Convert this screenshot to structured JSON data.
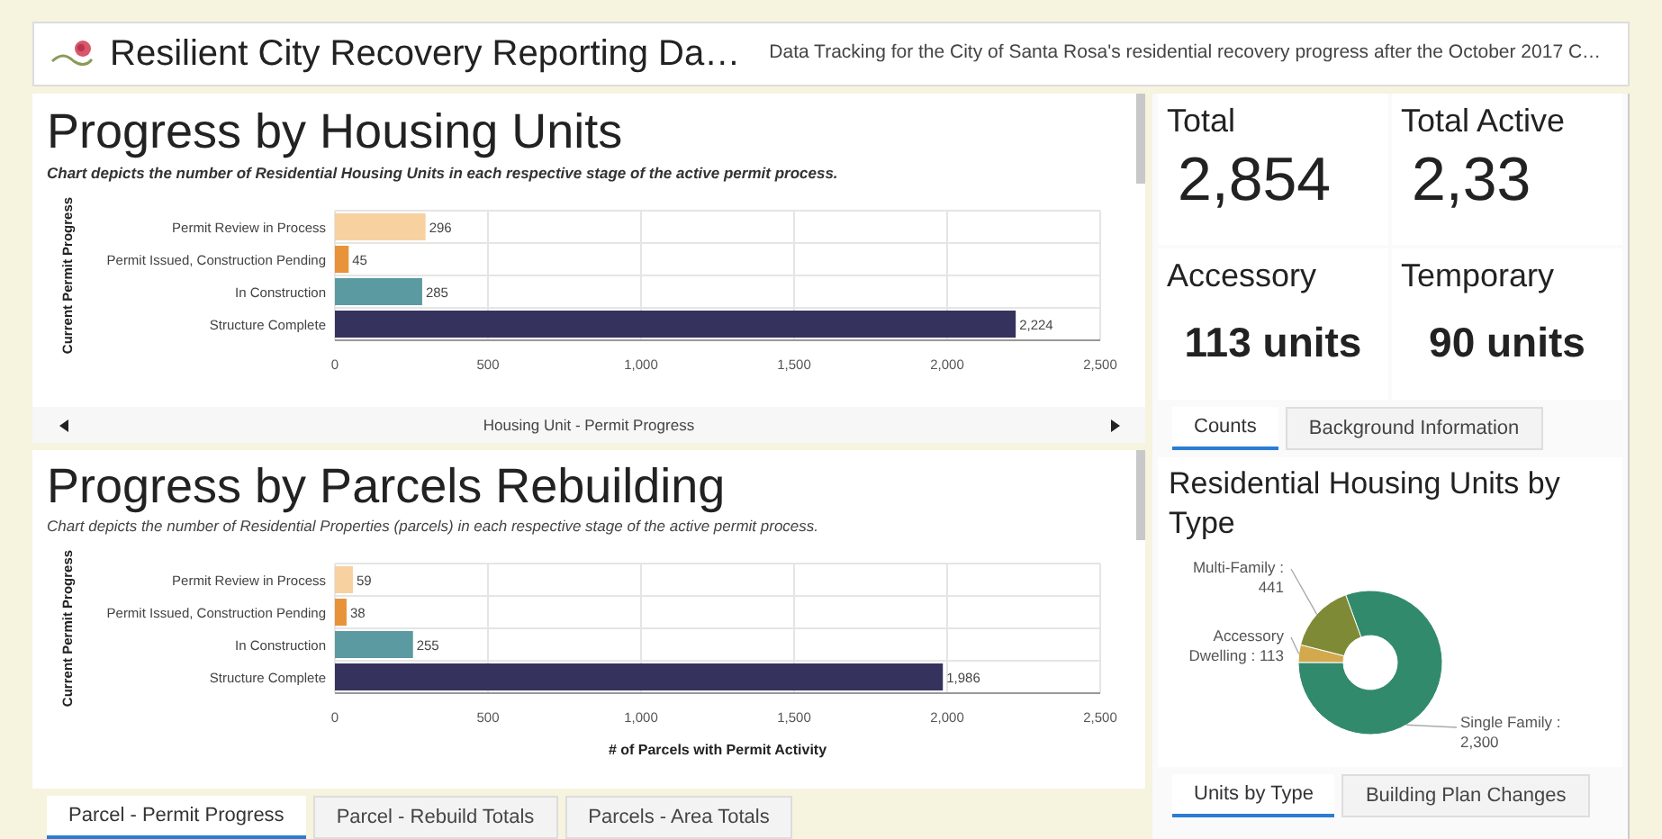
{
  "header": {
    "title": "Resilient City Recovery Reporting Da…",
    "subtitle": "Data Tracking for the City of Santa Rosa's residential recovery progress after the October 2017 C…"
  },
  "housing_panel": {
    "title": "Progress by Housing Units",
    "description": "Chart depicts the number of Residential Housing Units in each respective stage of the active permit process.",
    "chart_data": {
      "type": "bar",
      "orientation": "horizontal",
      "grid": true,
      "ylabel": "Current Permit Progress",
      "categories": [
        "Permit Review in Process",
        "Permit Issued, Construction Pending",
        "In Construction",
        "Structure Complete"
      ],
      "values": [
        296,
        45,
        285,
        2224
      ],
      "colors": [
        "#f8d1a0",
        "#e8923a",
        "#5a9aa0",
        "#35325e"
      ],
      "xlim": [
        0,
        2500
      ],
      "xticks": [
        {
          "value": 0,
          "label": "0"
        },
        {
          "value": 500,
          "label": "500"
        },
        {
          "value": 1000,
          "label": "1,000"
        },
        {
          "value": 1500,
          "label": "1,500"
        },
        {
          "value": 2000,
          "label": "2,000"
        },
        {
          "value": 2500,
          "label": "2,500"
        }
      ],
      "value_labels": [
        "296",
        "45",
        "285",
        "2,224"
      ]
    },
    "caption": "Housing Unit - Permit Progress"
  },
  "parcels_panel": {
    "title": "Progress by Parcels Rebuilding",
    "description": "Chart depicts the number of Residential Properties (parcels) in each respective stage of the active permit process.",
    "chart_data": {
      "type": "bar",
      "orientation": "horizontal",
      "grid": true,
      "ylabel": "Current Permit Progress",
      "xlabel": "# of Parcels with Permit Activity",
      "categories": [
        "Permit Review in Process",
        "Permit Issued, Construction Pending",
        "In Construction",
        "Structure Complete"
      ],
      "values": [
        59,
        38,
        255,
        1986
      ],
      "colors": [
        "#f8d1a0",
        "#e8923a",
        "#5a9aa0",
        "#35325e"
      ],
      "xlim": [
        0,
        2500
      ],
      "xticks": [
        {
          "value": 0,
          "label": "0"
        },
        {
          "value": 500,
          "label": "500"
        },
        {
          "value": 1000,
          "label": "1,000"
        },
        {
          "value": 1500,
          "label": "1,500"
        },
        {
          "value": 2000,
          "label": "2,000"
        },
        {
          "value": 2500,
          "label": "2,500"
        }
      ],
      "value_labels": [
        "59",
        "38",
        "255",
        "1,986"
      ]
    },
    "tabs": [
      {
        "label": "Parcel - Permit Progress",
        "selected": true
      },
      {
        "label": "Parcel - Rebuild Totals",
        "selected": false
      },
      {
        "label": "Parcels - Area Totals",
        "selected": false
      }
    ]
  },
  "counts": {
    "tiles": [
      {
        "label": "Total",
        "value": "2,854",
        "kind": "number"
      },
      {
        "label": "Total Active",
        "value": "2,33",
        "kind": "number"
      },
      {
        "label": "Accessory",
        "value": "113 units",
        "kind": "units"
      },
      {
        "label": "Temporary",
        "value": "90 units",
        "kind": "units"
      }
    ],
    "tabs": [
      {
        "label": "Counts",
        "selected": true
      },
      {
        "label": "Background Information",
        "selected": false
      }
    ]
  },
  "types_panel": {
    "title": "Residential Housing Units by Type",
    "chart_data": {
      "type": "donut",
      "categories": [
        "Single Family",
        "Accessory Dwelling",
        "Multi-Family"
      ],
      "values": [
        2300,
        113,
        441
      ],
      "colors": [
        "#328a6c",
        "#d3a94e",
        "#7f8a36"
      ],
      "value_labels": [
        "2,300",
        "113",
        "441"
      ]
    },
    "label_separator": ":",
    "tabs": [
      {
        "label": "Units by Type",
        "selected": true
      },
      {
        "label": "Building Plan Changes",
        "selected": false
      }
    ]
  }
}
